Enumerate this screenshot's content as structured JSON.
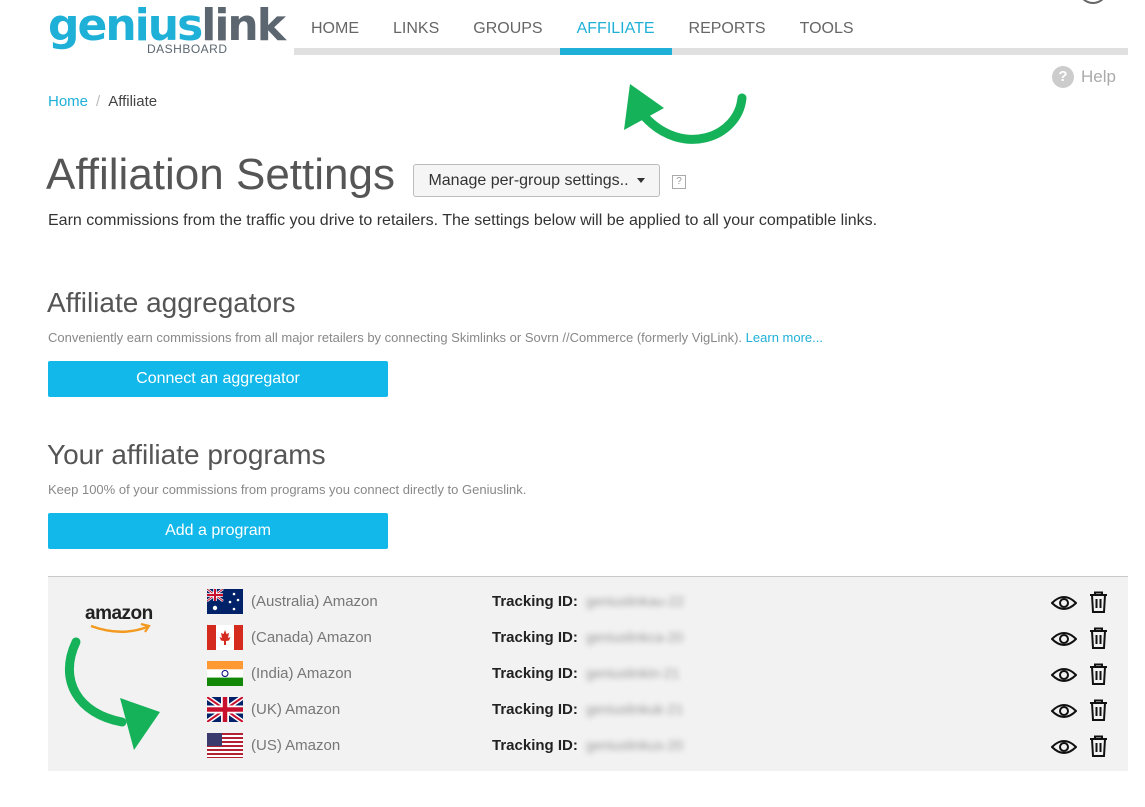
{
  "logo": {
    "part1": "geni",
    "part2": "us",
    "part3": "link",
    "sub": "DASHBOARD"
  },
  "nav": [
    {
      "label": "HOME"
    },
    {
      "label": "LINKS"
    },
    {
      "label": "GROUPS"
    },
    {
      "label": "AFFILIATE",
      "active": true
    },
    {
      "label": "REPORTS"
    },
    {
      "label": "TOOLS"
    }
  ],
  "help": {
    "label": "Help",
    "icon": "question-circle-icon"
  },
  "breadcrumb": {
    "home": "Home",
    "current": "Affiliate"
  },
  "page": {
    "title": "Affiliation Settings",
    "manage_button": "Manage per-group settings..",
    "q_icon": "?",
    "intro": "Earn commissions from the traffic you drive to retailers. The settings below will be applied to all your compatible links."
  },
  "aggregators": {
    "title": "Affiliate aggregators",
    "desc": "Conveniently earn commissions from all major retailers by connecting Skimlinks or Sovrn //Commerce (formerly VigLink).",
    "learn_more": "Learn more...",
    "button": "Connect an aggregator"
  },
  "programs": {
    "title": "Your affiliate programs",
    "desc": "Keep 100% of your commissions from programs you connect directly to Geniuslink.",
    "button": "Add a program",
    "retailer": "amazon",
    "tracking_label": "Tracking ID:",
    "rows": [
      {
        "name": "(Australia) Amazon",
        "flag": "au",
        "tracking_id": "geniuslinkau-22"
      },
      {
        "name": "(Canada) Amazon",
        "flag": "ca",
        "tracking_id": "geniuslinkca-20"
      },
      {
        "name": "(India) Amazon",
        "flag": "in",
        "tracking_id": "geniuslinkin-21"
      },
      {
        "name": "(UK) Amazon",
        "flag": "uk",
        "tracking_id": "geniuslinkuk-21"
      },
      {
        "name": "(US) Amazon",
        "flag": "us",
        "tracking_id": "geniuslinkus-20"
      }
    ]
  },
  "colors": {
    "accent": "#1fb0d8",
    "button": "#12b8e9",
    "arrow": "#16b25a"
  }
}
